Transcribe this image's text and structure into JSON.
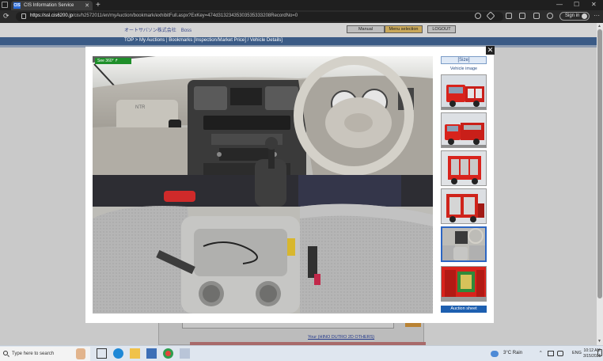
{
  "browser": {
    "tab_title": "CIS Information Service",
    "tab_favicon": "CIS",
    "tab_close": "✕",
    "new_tab": "+",
    "url_host": "https://ssl.cis6200.jp",
    "url_path": "/cis/h2572011/en/myAuction/bookmark/exhibitFull.aspx?ExKey=474d31323435303535333208RecordNo=0",
    "signin_label": "Sign in",
    "window_controls": {
      "minimize": "—",
      "maximize": "☐",
      "close": "✕"
    }
  },
  "page": {
    "company": "オートサバソン株式会社　Boss",
    "manual_label": "Manual",
    "menu_selection_label": "Menu selection",
    "logout_label": "LOGOUT",
    "breadcrumb": "TOP > My Auctions | Bookmarks [Inspection/Market Price] / Vehicle Details]",
    "model_link": "Your (HINO DUTRO 2D OTHERS)"
  },
  "modal": {
    "see360_label": "See 360° ↱",
    "size_button": "[Size]",
    "vehicle_image_label": "Vehicle image",
    "auction_sheet_label": "Auction sheet",
    "close_label": "✕",
    "thumbnails": [
      "exterior-front",
      "exterior-side",
      "exterior-rear",
      "exterior-rear-quarter",
      "interior-cab",
      "equipment-bay"
    ],
    "active_thumbnail": 4
  },
  "taskbar": {
    "search_placeholder": "Type here to search",
    "weather": "3°C  Rain",
    "language": "ENG",
    "time": "10:12 AM",
    "date": "3/15/2025"
  },
  "colors": {
    "navbar": "#3b5b86",
    "see360_green": "#1f8f2a",
    "auction_sheet_blue": "#1d5fb0",
    "truck_red": "#d8231c"
  }
}
